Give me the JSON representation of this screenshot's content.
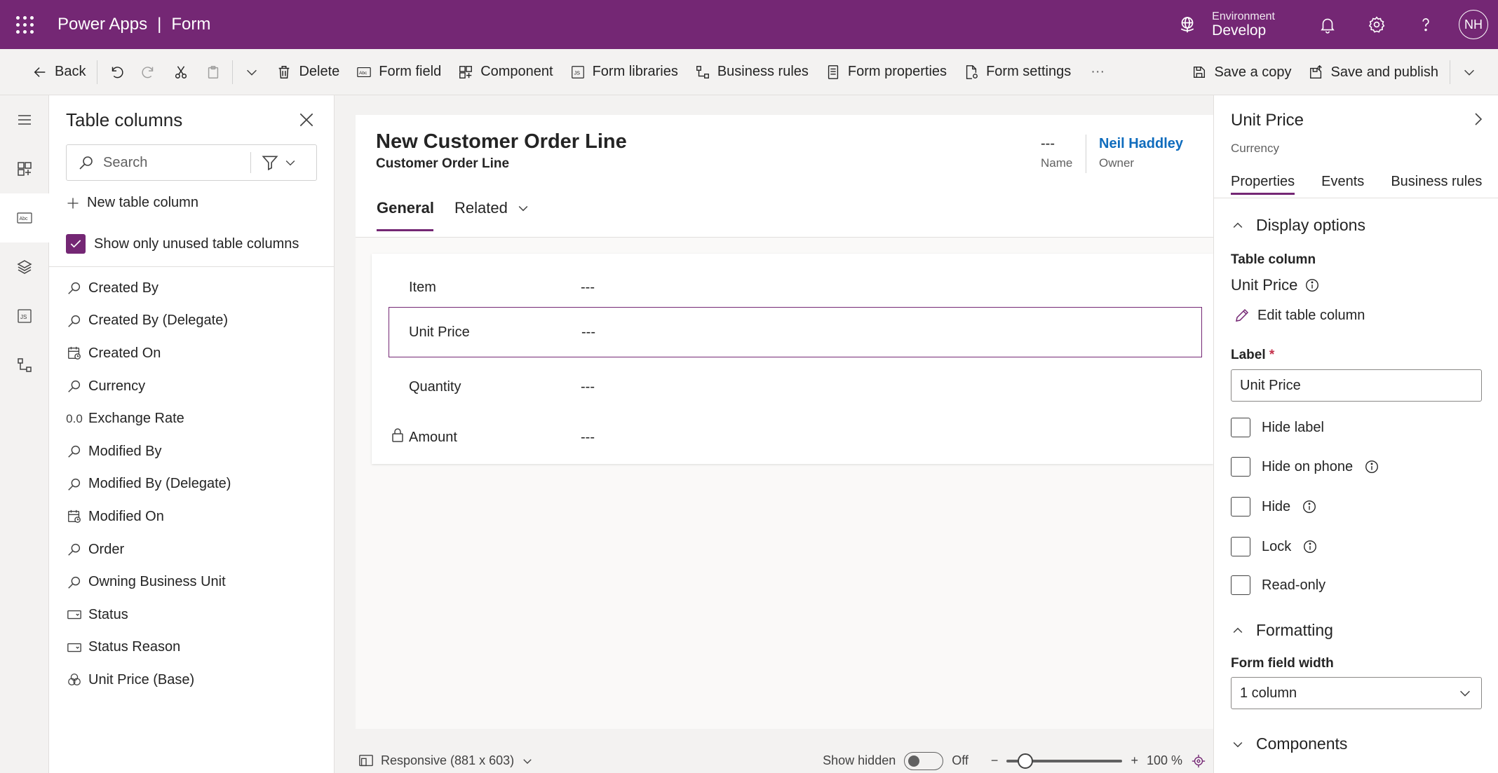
{
  "header": {
    "app_name": "Power Apps",
    "divider": "|",
    "page": "Form",
    "environment_label": "Environment",
    "environment_value": "Develop",
    "avatar_initials": "NH"
  },
  "toolbar": {
    "back": "Back",
    "delete": "Delete",
    "form_field": "Form field",
    "component": "Component",
    "form_libraries": "Form libraries",
    "business_rules": "Business rules",
    "form_properties": "Form properties",
    "form_settings": "Form settings",
    "more": "···",
    "save_copy": "Save a copy",
    "save_publish": "Save and publish"
  },
  "columns_panel": {
    "title": "Table columns",
    "search_placeholder": "Search",
    "new_column": "New table column",
    "show_unused": "Show only unused table columns",
    "items": [
      {
        "label": "Created By",
        "icon": "lookup-icon"
      },
      {
        "label": "Created By (Delegate)",
        "icon": "lookup-icon"
      },
      {
        "label": "Created On",
        "icon": "calendar-icon"
      },
      {
        "label": "Currency",
        "icon": "lookup-icon"
      },
      {
        "label": "Exchange Rate",
        "icon": "decimal-icon",
        "glyph": "0.0"
      },
      {
        "label": "Modified By",
        "icon": "lookup-icon"
      },
      {
        "label": "Modified By (Delegate)",
        "icon": "lookup-icon"
      },
      {
        "label": "Modified On",
        "icon": "calendar-icon"
      },
      {
        "label": "Order",
        "icon": "lookup-icon"
      },
      {
        "label": "Owning Business Unit",
        "icon": "lookup-icon"
      },
      {
        "label": "Status",
        "icon": "option-set-icon"
      },
      {
        "label": "Status Reason",
        "icon": "option-set-icon"
      },
      {
        "label": "Unit Price (Base)",
        "icon": "currency-icon"
      }
    ]
  },
  "form": {
    "title": "New Customer Order Line",
    "subtitle": "Customer Order Line",
    "name_value": "---",
    "name_label": "Name",
    "owner_value": "Neil Haddley",
    "owner_label": "Owner",
    "tabs": [
      "General",
      "Related"
    ],
    "fields": [
      {
        "label": "Item",
        "value": "---"
      },
      {
        "label": "Unit Price",
        "value": "---"
      },
      {
        "label": "Quantity",
        "value": "---"
      },
      {
        "label": "Amount",
        "value": "---"
      }
    ]
  },
  "statusbar": {
    "layout": "Responsive (881 x 603)",
    "show_hidden": "Show hidden",
    "toggle_state": "Off",
    "zoom": "100 %",
    "zoom_level": 0.16
  },
  "properties": {
    "title": "Unit Price",
    "subtitle": "Currency",
    "tabs": [
      "Properties",
      "Events",
      "Business rules"
    ],
    "display_options": "Display options",
    "table_column_label": "Table column",
    "table_column_value": "Unit Price",
    "edit_column": "Edit table column",
    "label_label": "Label",
    "required_mark": "*",
    "label_value": "Unit Price",
    "checks": [
      "Hide label",
      "Hide on phone",
      "Hide",
      "Lock",
      "Read-only"
    ],
    "formatting": "Formatting",
    "width_label": "Form field width",
    "width_value": "1 column",
    "components": "Components"
  },
  "colors": {
    "brand": "#742774",
    "link": "#0f6cbd"
  }
}
